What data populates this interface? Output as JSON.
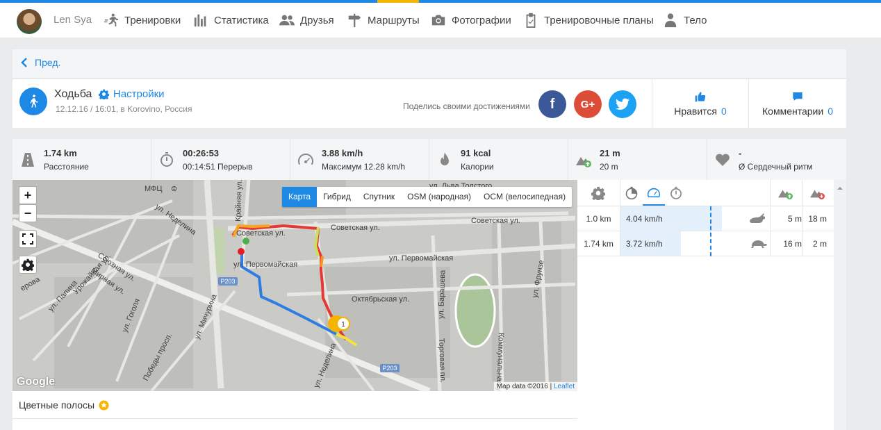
{
  "nav": {
    "username": "Len Sya",
    "items": [
      {
        "label": "Тренировки",
        "icon": "running-icon"
      },
      {
        "label": "Статистика",
        "icon": "bar-chart-icon"
      },
      {
        "label": "Друзья",
        "icon": "friends-icon"
      },
      {
        "label": "Маршруты",
        "icon": "signpost-icon"
      },
      {
        "label": "Фотографии",
        "icon": "camera-icon"
      },
      {
        "label": "Тренировочные планы",
        "icon": "clipboard-icon"
      },
      {
        "label": "Тело",
        "icon": "body-icon"
      }
    ]
  },
  "prev": {
    "label": "Пред."
  },
  "activity": {
    "title": "Ходьба",
    "settings_label": "Настройки",
    "meta": "12.12.16 / 16:01, в Korovino, Россия",
    "share_text": "Поделись своими достижениями",
    "likes_label": "Нравится",
    "likes_count": "0",
    "comments_label": "Комментарии",
    "comments_count": "0"
  },
  "stats": [
    {
      "value": "1.74 km",
      "label": "Расстояние",
      "icon": "road-icon"
    },
    {
      "value": "00:26:53",
      "label": "00:14:51 Перерыв",
      "icon": "stopwatch-icon"
    },
    {
      "value": "3.88 km/h",
      "label": "Максимум 12.28 km/h",
      "icon": "speedometer-icon"
    },
    {
      "value": "91 kcal",
      "label": "Калории",
      "icon": "flame-icon"
    },
    {
      "value": "21 m",
      "label": "20 m",
      "icon": "elevation-up-icon"
    },
    {
      "value": "-",
      "label": "Ø Сердечный ритм",
      "icon": "heart-icon"
    }
  ],
  "map": {
    "tabs": [
      "Карта",
      "Гибрид",
      "Спутник",
      "OSM (народная)",
      "OCM (велосипедная)"
    ],
    "active_tab": "Карта",
    "zoom_in": "+",
    "zoom_out": "−",
    "google": "Google",
    "attribution": "Map data ©2016",
    "attribution_link": "Leaflet",
    "marker_label": "1",
    "labels": {
      "mfc": "МФЦ",
      "tolstogo": "ул. Льва Толстого",
      "sovetskaya1": "Советская ул.",
      "sovetskaya2": "Советская ул.",
      "sovetskaya3": "Советская ул.",
      "pervomay1": "ул. Первомайская",
      "pervomay2": "ул. Первомайская",
      "oktyabr": "Октябрьская ул.",
      "nedelina1": "ул. Неделина",
      "nedelina2": "ул. Неделина",
      "krainyaya": "Крайняя ул.",
      "soyuznaya": "Союзная ул.",
      "mirnaya": "Мирная ул.",
      "urozhaynaya": "Урожайная ул.",
      "papina": "ул. Папина",
      "gogolya": "ул. Гоголя",
      "michurina": "ул. Мичурина",
      "pobedy": "Победы просп.",
      "barasheva": "ул. Барашева",
      "kommunalnaya": "Коммунальная ул.",
      "frunze": "ул. Фрунзе",
      "torgovaya": "Торговая пл.",
      "r203a": "Р203",
      "r203b": "Р203",
      "lerova": "ерова"
    }
  },
  "bands": {
    "label": "Цветные полосы"
  },
  "splits": {
    "rows": [
      {
        "distance": "1.0 km",
        "pace": "4.04 km/h",
        "pace_fraction": 0.97,
        "icon": "rabbit-icon",
        "up": "5 m",
        "down": "18 m"
      },
      {
        "distance": "1.74 km",
        "pace": "3.72 km/h",
        "pace_fraction": 0.58,
        "icon": "turtle-icon",
        "up": "16 m",
        "down": "2 m"
      }
    ]
  },
  "colors": {
    "accent": "#1e88e5",
    "facebook": "#3b5998",
    "google": "#dd4b39",
    "twitter": "#1da1f2",
    "highlight": "#f5b400"
  }
}
